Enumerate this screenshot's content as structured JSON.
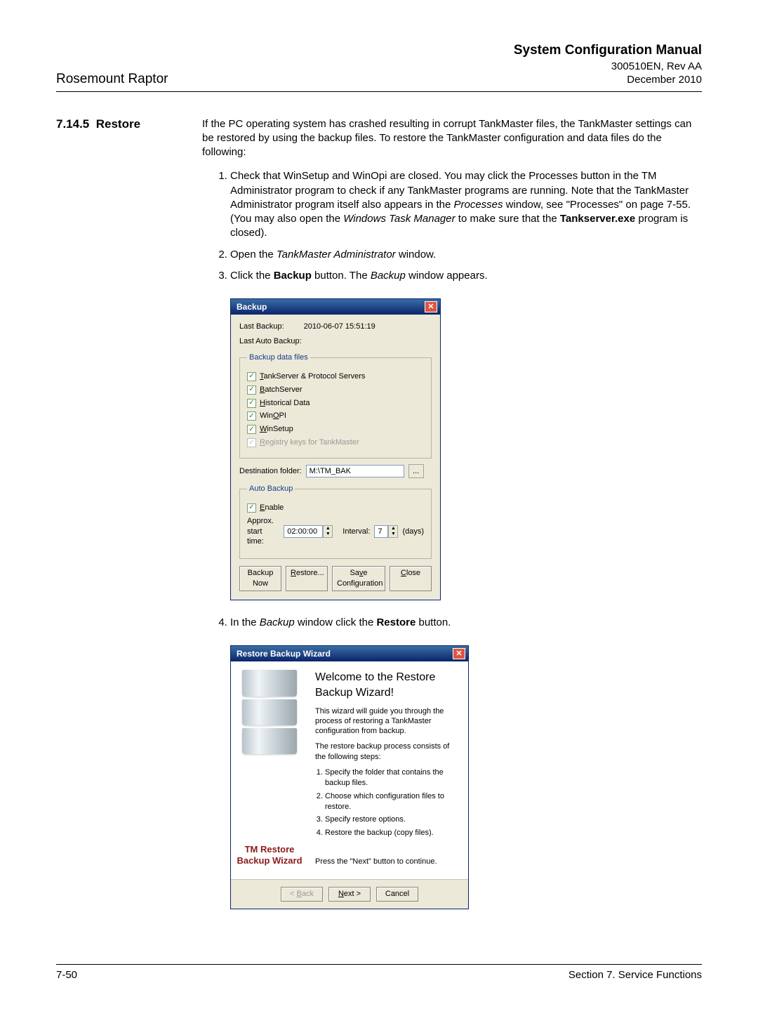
{
  "header": {
    "left": "Rosemount Raptor",
    "title": "System Configuration Manual",
    "docnum": "300510EN, Rev AA",
    "date": "December 2010"
  },
  "section": {
    "num": "7.14.5",
    "title": "Restore"
  },
  "intro": "If the PC operating system has crashed resulting in corrupt TankMaster files, the TankMaster settings can be restored by using the backup files. To restore the TankMaster configuration and data files do the following:",
  "steps": {
    "s1a": "Check that WinSetup and WinOpi are closed. You may click the Processes button in the TM Administrator program to check if any TankMaster programs are running. Note that the TankMaster Administrator program itself also appears in the ",
    "s1b": "Processes",
    "s1c": " window, see \"Processes\" on page 7-55. (You may also open the ",
    "s1d": "Windows Task Manager",
    "s1e": " to make sure that the ",
    "s1f": "Tankserver.exe",
    "s1g": " program is closed).",
    "s2a": "Open the ",
    "s2b": "TankMaster Administrator",
    "s2c": " window.",
    "s3a": "Click the ",
    "s3b": "Backup",
    "s3c": " button. The ",
    "s3d": "Backup",
    "s3e": " window appears.",
    "s4a": "In the ",
    "s4b": "Backup",
    "s4c": " window click the ",
    "s4d": "Restore",
    "s4e": " button."
  },
  "backup": {
    "title": "Backup",
    "last_label": "Last Backup:",
    "last_value": "2010-06-07 15:51:19",
    "last_auto_label": "Last Auto Backup:",
    "group_files": "Backup data files",
    "chk_tankserver": "TankServer & Protocol Servers",
    "chk_batch": "BatchServer",
    "chk_hist": "Historical Data",
    "chk_winopi": "WinOPI",
    "chk_winsetup": "WinSetup",
    "chk_reg": "Registry keys for TankMaster",
    "dest_label": "Destination folder:",
    "dest_value": "M:\\TM_BAK",
    "group_auto": "Auto Backup",
    "chk_enable": "Enable",
    "start_label": "Approx. start time:",
    "start_value": "02:00:00",
    "interval_label": "Interval:",
    "interval_value": "7",
    "interval_unit": "(days)",
    "btn_backup": "Backup Now",
    "btn_restore": "Restore...",
    "btn_save": "Save Configuration",
    "btn_close": "Close"
  },
  "wizard": {
    "title": "Restore Backup Wizard",
    "left_title": "TM Restore Backup Wizard",
    "heading": "Welcome to the Restore Backup Wizard!",
    "p1": "This wizard will guide you through the process of restoring a TankMaster configuration from backup.",
    "p2": "The restore backup process consists of the following steps:",
    "li1": "Specify the folder that contains the backup files.",
    "li2": "Choose which configuration files to restore.",
    "li3": "Specify restore options.",
    "li4": "Restore the backup (copy files).",
    "p3": "Press the \"Next\" button to continue.",
    "btn_back": "< Back",
    "btn_next": "Next >",
    "btn_cancel": "Cancel"
  },
  "footer": {
    "page": "7-50",
    "section": "Section 7. Service Functions"
  }
}
